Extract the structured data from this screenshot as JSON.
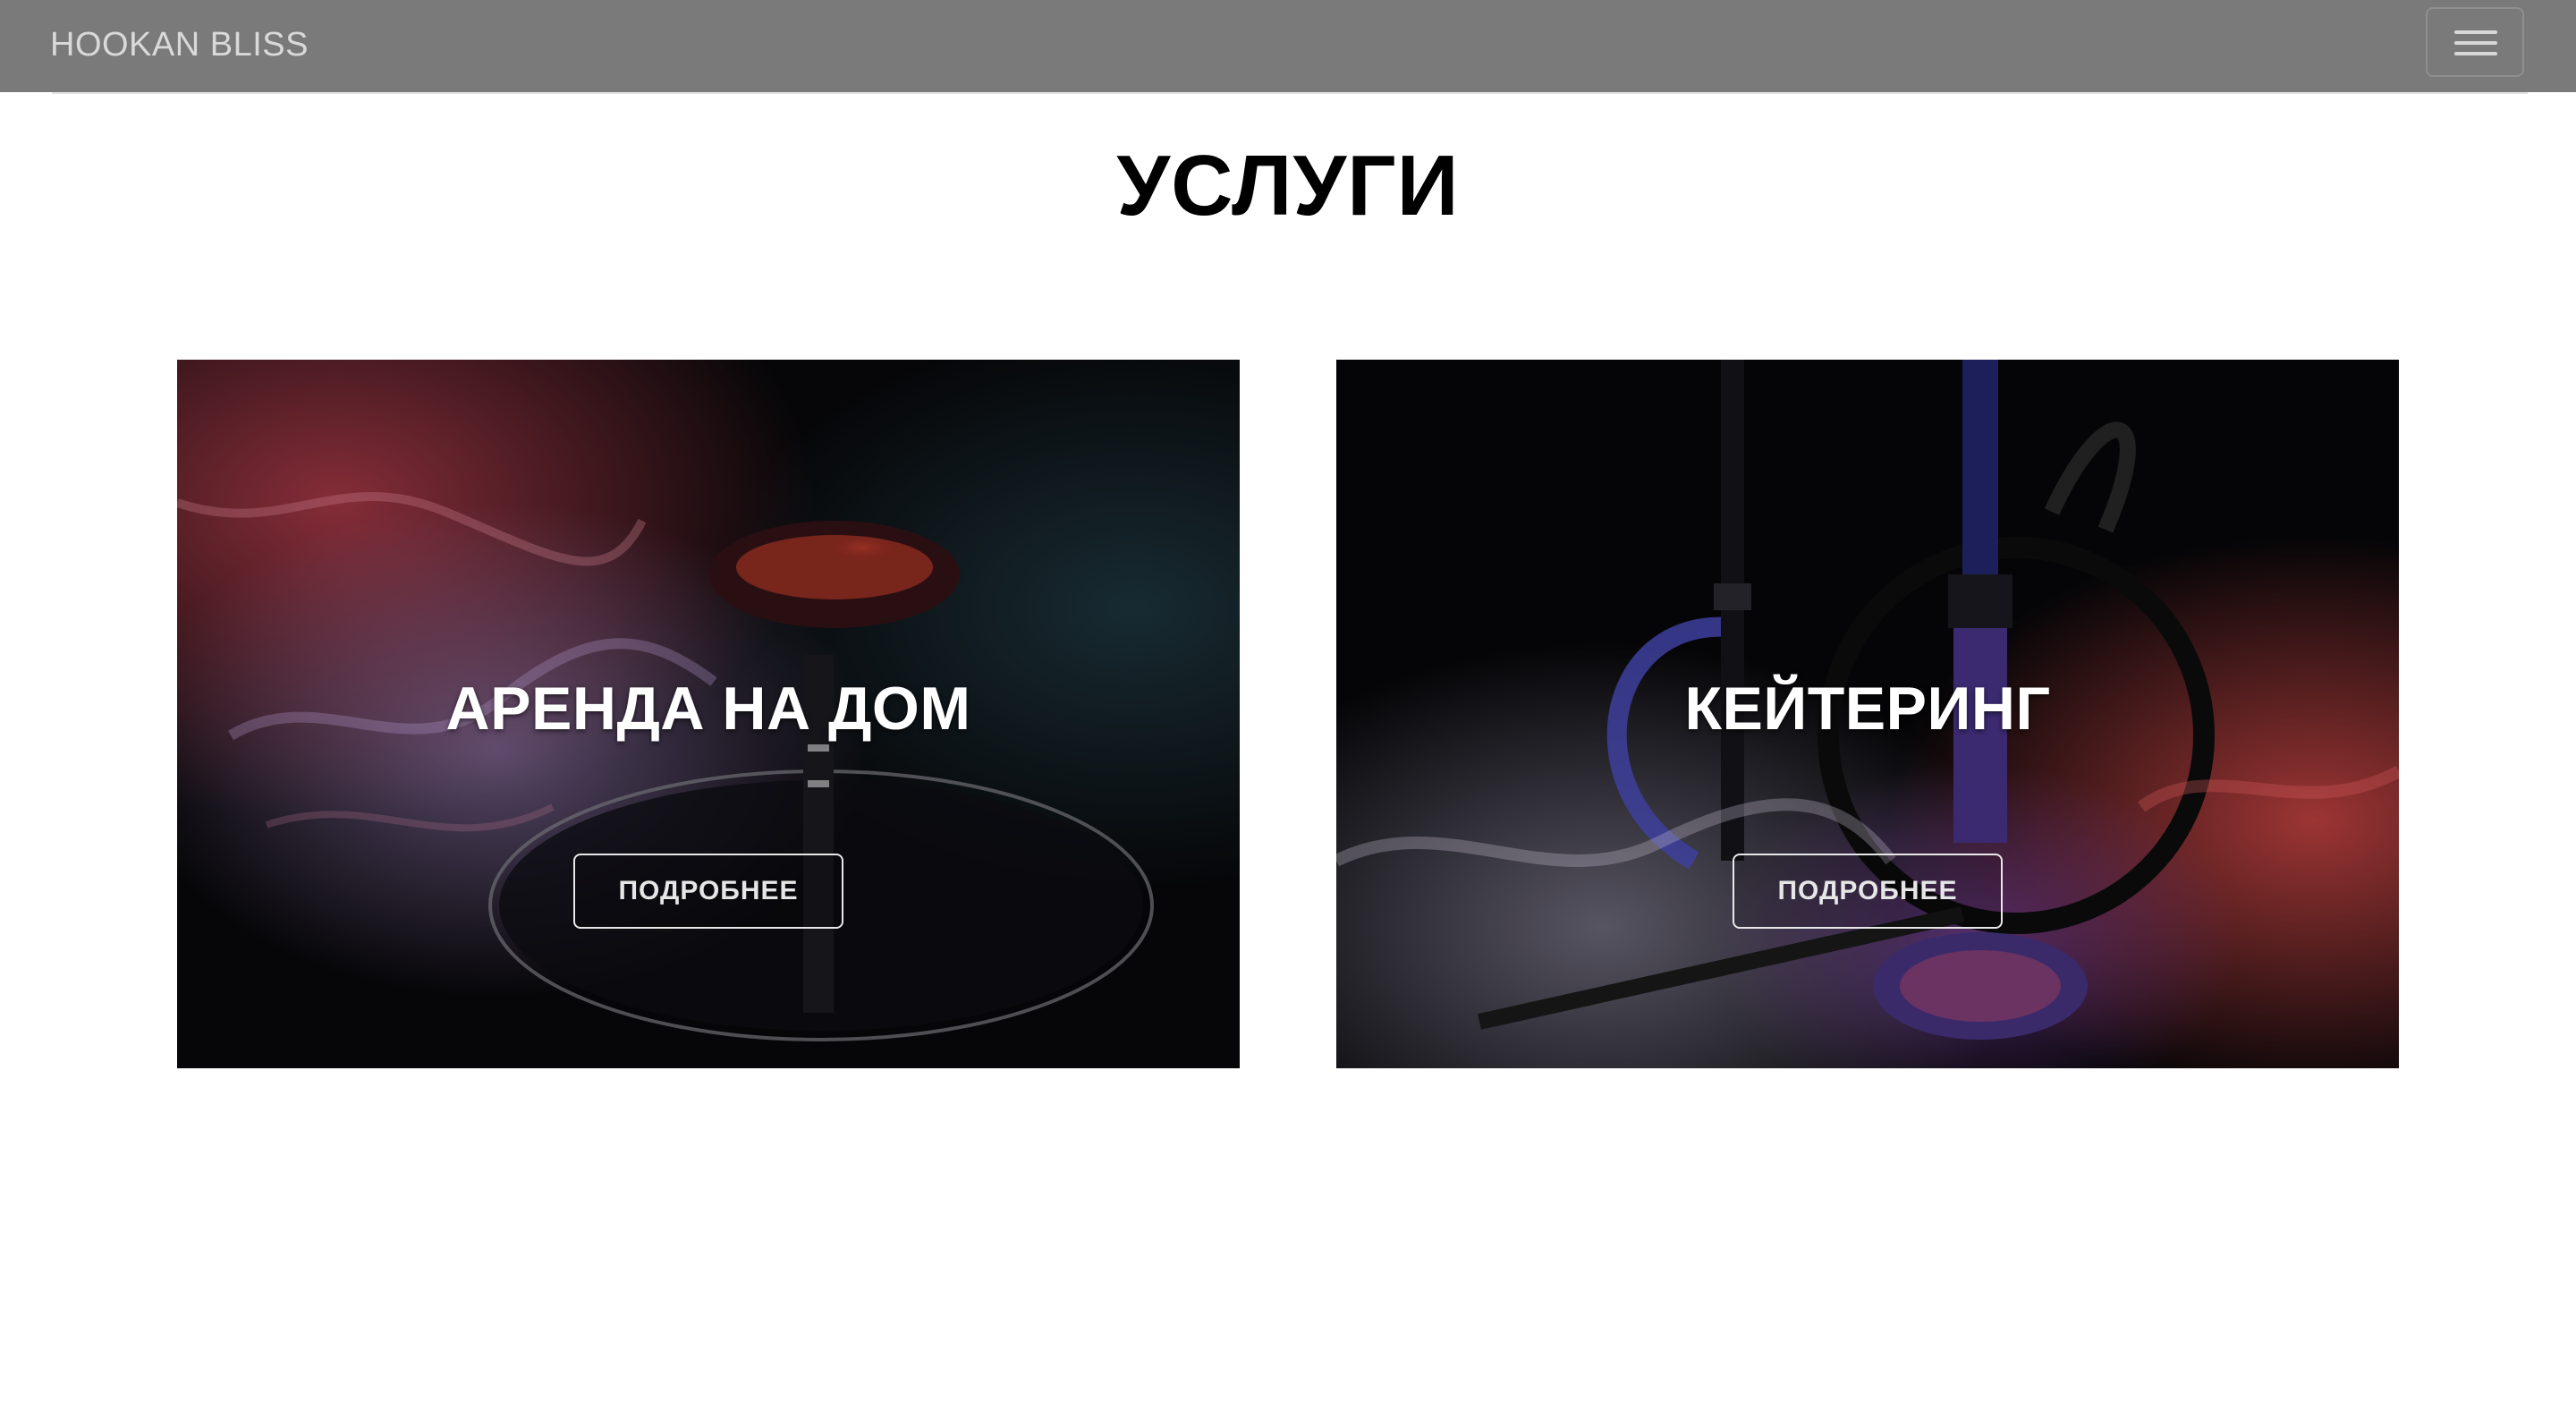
{
  "navbar": {
    "brand": "HOOKAN BLISS",
    "menu_icon": "hamburger-menu-icon"
  },
  "main": {
    "title": "УСЛУГИ",
    "cards": [
      {
        "title": "АРЕНДА НА ДОМ",
        "button_label": "ПОДРОБНЕЕ",
        "image": "hookah-bowl-smoke-image"
      },
      {
        "title": "КЕЙТЕРИНГ",
        "button_label": "ПОДРОБНЕЕ",
        "image": "hookah-smoke-image"
      }
    ]
  },
  "colors": {
    "navbar_bg": "#7a7a7a",
    "brand_text": "#d9d9d9",
    "title_text": "#000000",
    "card_text": "#ffffff",
    "smoke_red": "#b03a48",
    "smoke_violet": "#9b7fb8"
  }
}
